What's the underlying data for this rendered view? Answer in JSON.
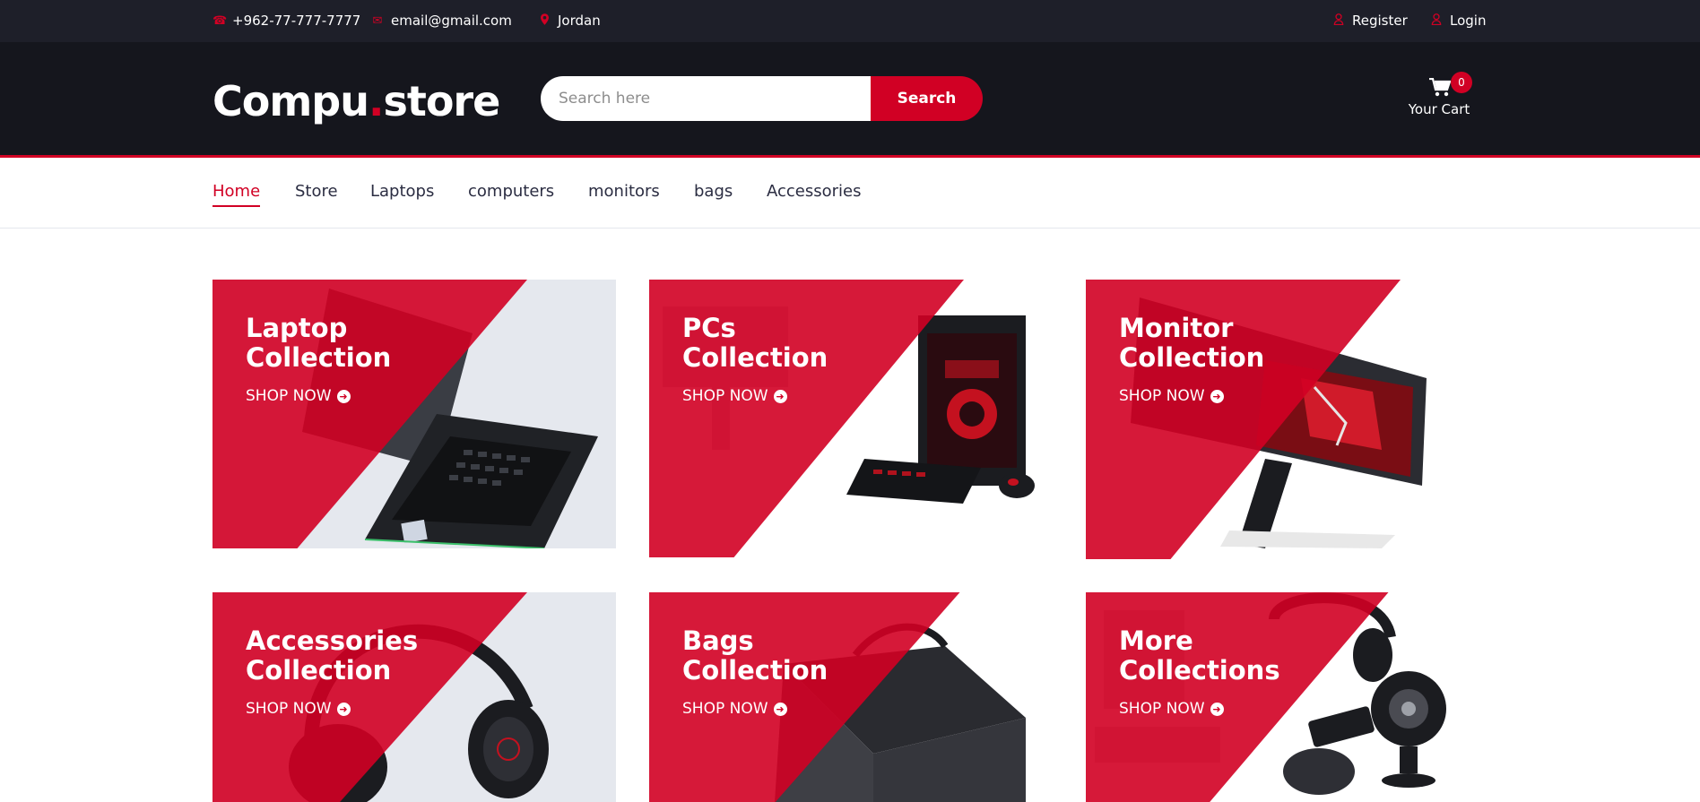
{
  "topbar": {
    "phone": "+962-77-777-7777",
    "email": "email@gmail.com",
    "location": "Jordan",
    "register": "Register",
    "login": "Login"
  },
  "header": {
    "logo_part1": "Compu",
    "logo_dot": ".",
    "logo_part2": "store",
    "search_placeholder": "Search here",
    "search_button": "Search",
    "cart_label": "Your Cart",
    "cart_count": "0"
  },
  "nav": [
    "Home",
    "Store",
    "Laptops",
    "computers",
    "monitors",
    "bags",
    "Accessories"
  ],
  "collections": [
    {
      "line1": "Laptop",
      "line2": "Collection",
      "cta": "SHOP NOW"
    },
    {
      "line1": "PCs",
      "line2": "Collection",
      "cta": "SHOP NOW"
    },
    {
      "line1": "Monitor",
      "line2": "Collection",
      "cta": "SHOP NOW"
    },
    {
      "line1": "Accessories",
      "line2": "Collection",
      "cta": "SHOP NOW"
    },
    {
      "line1": "Bags",
      "line2": "Collection",
      "cta": "SHOP NOW"
    },
    {
      "line1": "More",
      "line2": "Collections",
      "cta": "SHOP NOW"
    }
  ],
  "colors": {
    "accent": "#D10024",
    "topbar": "#1e1f29",
    "header": "#15161d"
  },
  "icons": {
    "phone": "phone-icon",
    "email": "envelope-icon",
    "location": "map-marker-icon",
    "user": "user-icon",
    "cart": "shopping-cart-icon",
    "arrow": "arrow-circle-right-icon"
  }
}
